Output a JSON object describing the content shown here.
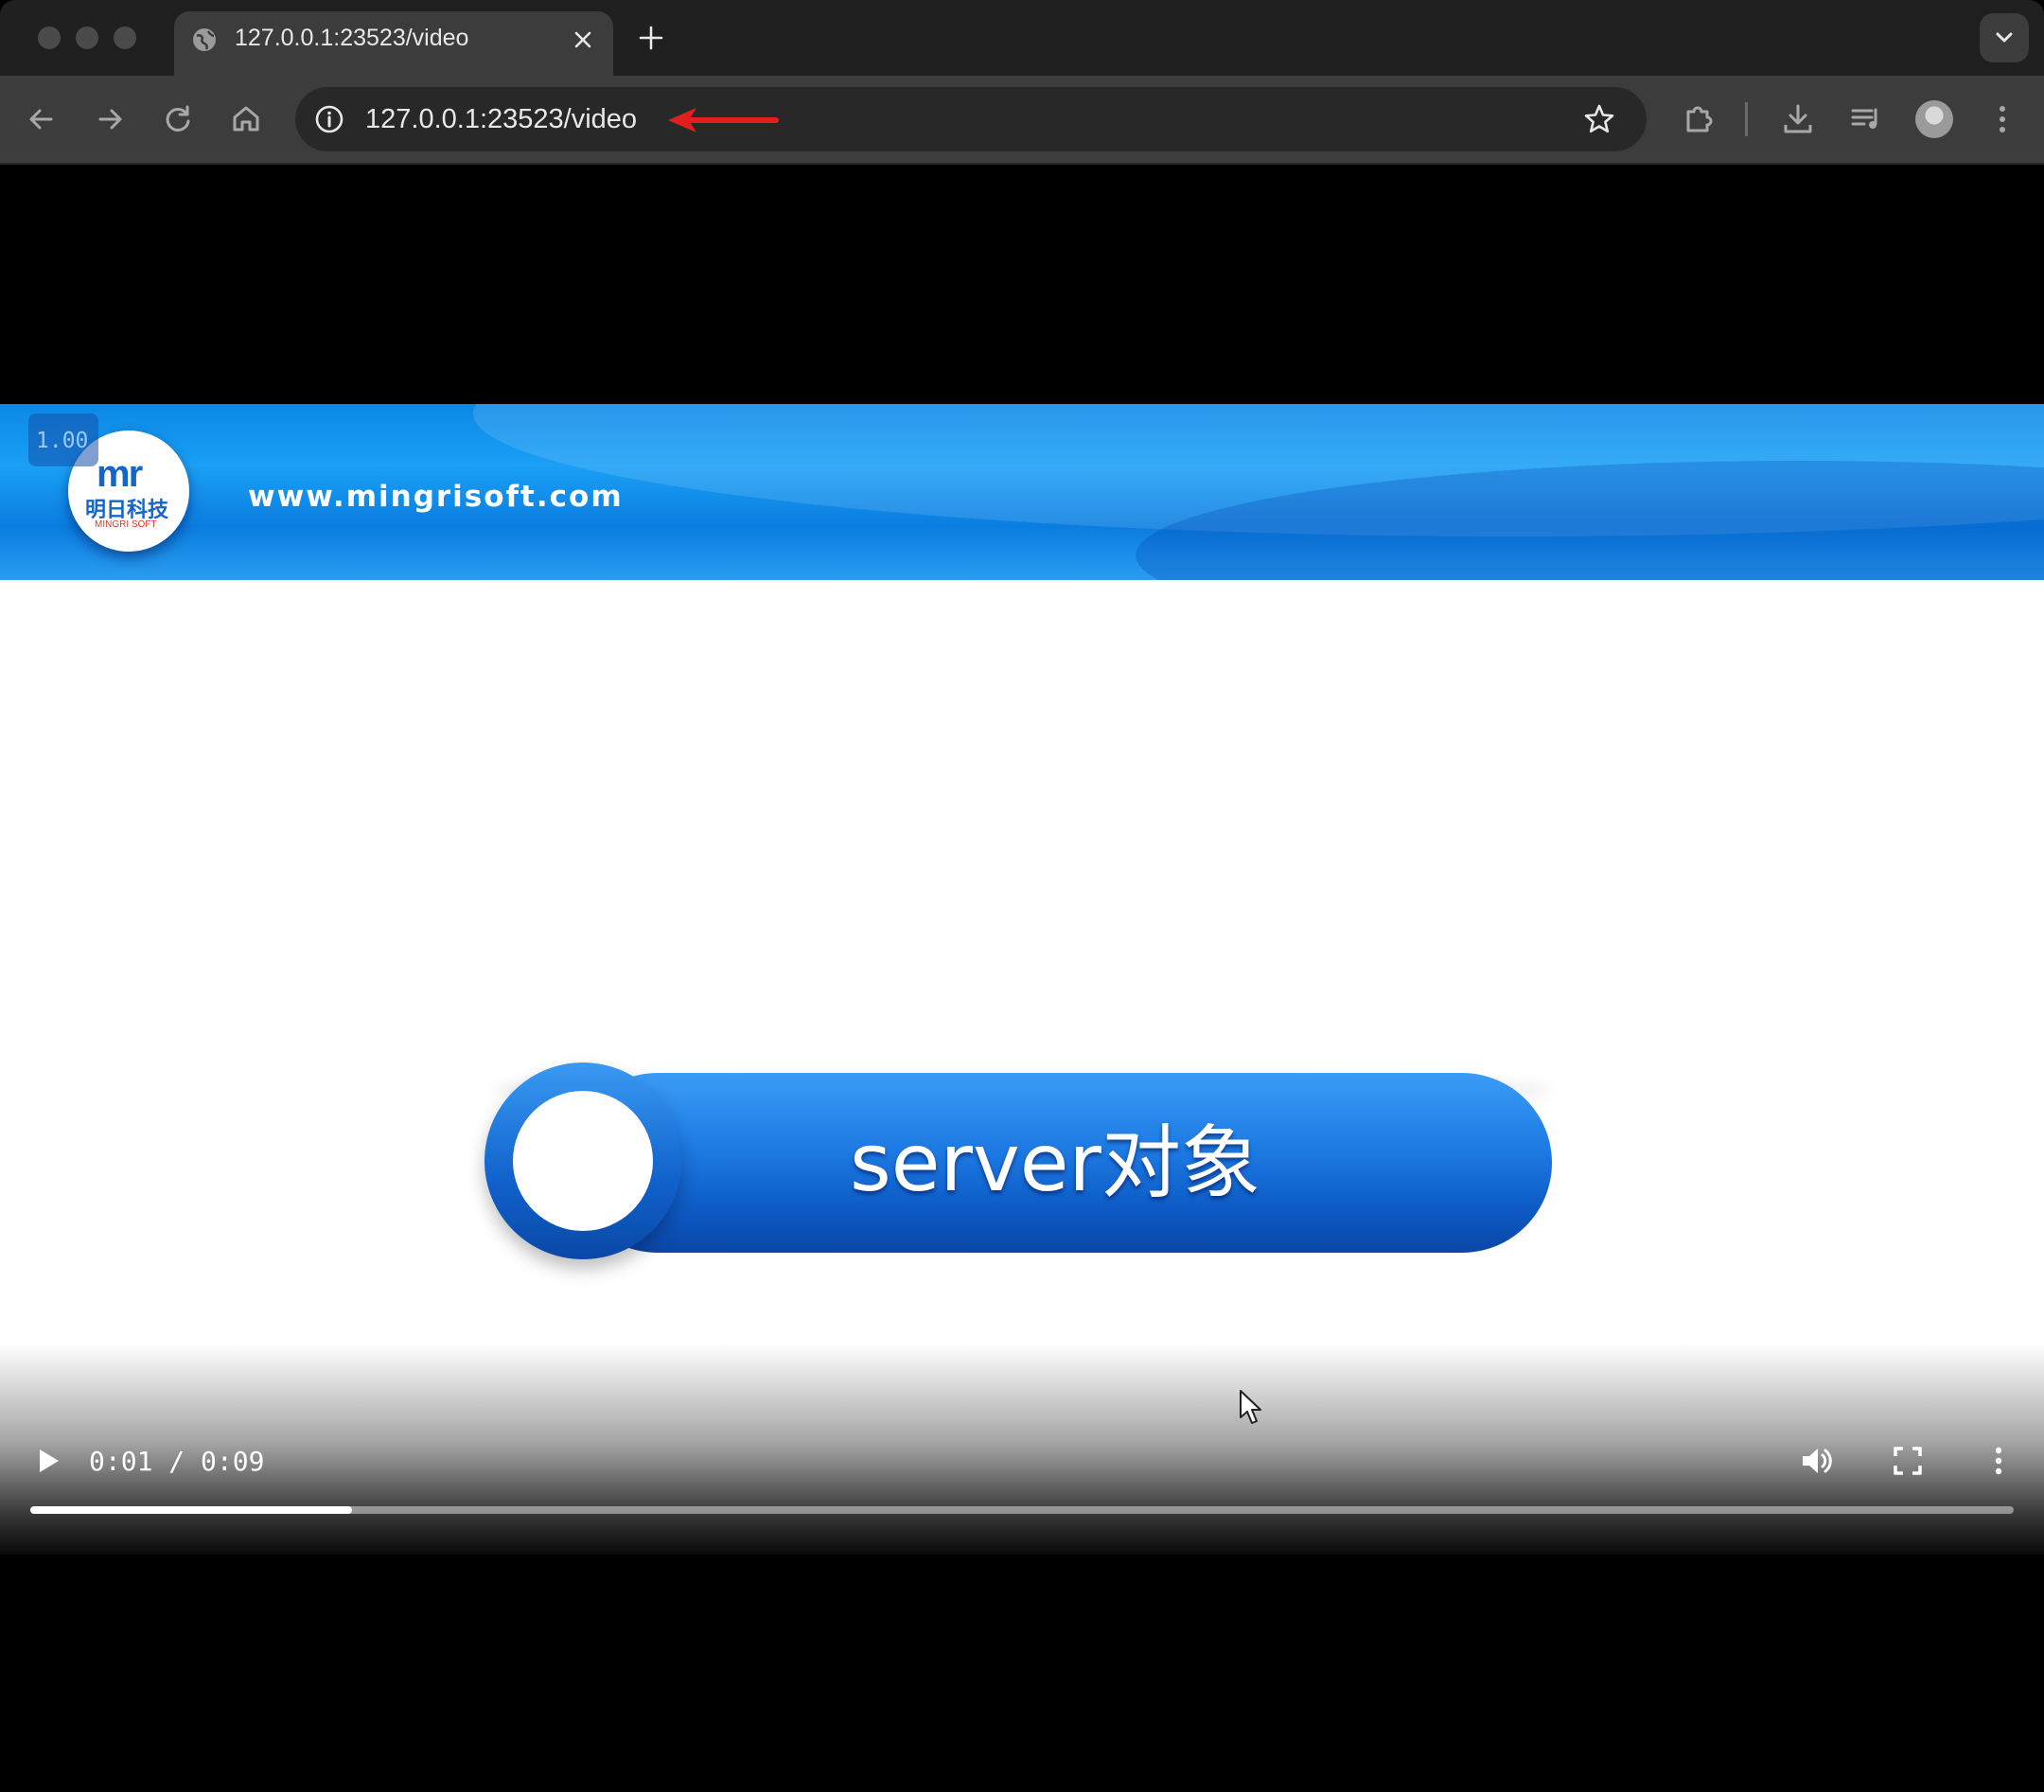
{
  "tab": {
    "title": "127.0.0.1:23523/video",
    "close_icon": "close-icon",
    "favicon": "globe-icon"
  },
  "toolbar": {
    "url": "127.0.0.1:23523/video",
    "icons": [
      "back-icon",
      "forward-icon",
      "reload-icon",
      "home-icon",
      "site-info-icon",
      "bookmark-star-icon",
      "extensions-icon",
      "download-icon",
      "media-control-icon",
      "profile-avatar",
      "menu-icon"
    ]
  },
  "annotation": {
    "arrow_color": "#e0201e"
  },
  "video": {
    "speed_badge": "1.00",
    "logo": {
      "mark": "mr",
      "cn": "明日科技",
      "en": "MINGRI SOFT"
    },
    "site_url": "www.mingrisoft.com",
    "slide_title": "server对象",
    "time_display": "0:01 / 0:09",
    "progress_fraction": 0.162,
    "accent": "#1c78e2"
  }
}
